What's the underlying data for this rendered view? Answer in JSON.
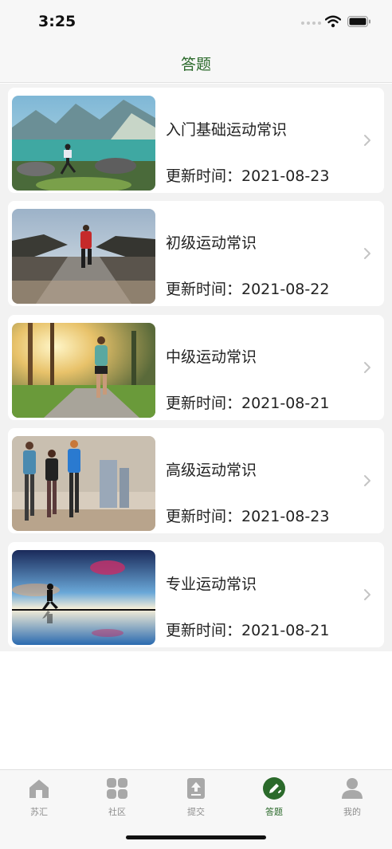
{
  "status_bar": {
    "time": "3:25"
  },
  "nav": {
    "title": "答题"
  },
  "list": {
    "items": [
      {
        "title": "入门基础运动常识",
        "date": "更新时间：2021-08-23",
        "image": "runner-lakeside-mountains"
      },
      {
        "title": "初级运动常识",
        "date": "更新时间：2021-08-22",
        "image": "runner-road-back-view"
      },
      {
        "title": "中级运动常识",
        "date": "更新时间：2021-08-21",
        "image": "runner-park-sunlight"
      },
      {
        "title": "高级运动常识",
        "date": "更新时间：2021-08-23",
        "image": "group-jogging-winter"
      },
      {
        "title": "专业运动常识",
        "date": "更新时间：2021-08-21",
        "image": "runner-silhouette-sunset"
      }
    ]
  },
  "tab_bar": {
    "active_color": "#2b6a2b",
    "tabs": [
      {
        "label": "苏汇",
        "icon": "home-icon"
      },
      {
        "label": "社区",
        "icon": "grid-icon"
      },
      {
        "label": "提交",
        "icon": "upload-icon"
      },
      {
        "label": "答题",
        "icon": "pencil-badge-icon",
        "active": true
      },
      {
        "label": "我的",
        "icon": "person-icon"
      }
    ]
  }
}
